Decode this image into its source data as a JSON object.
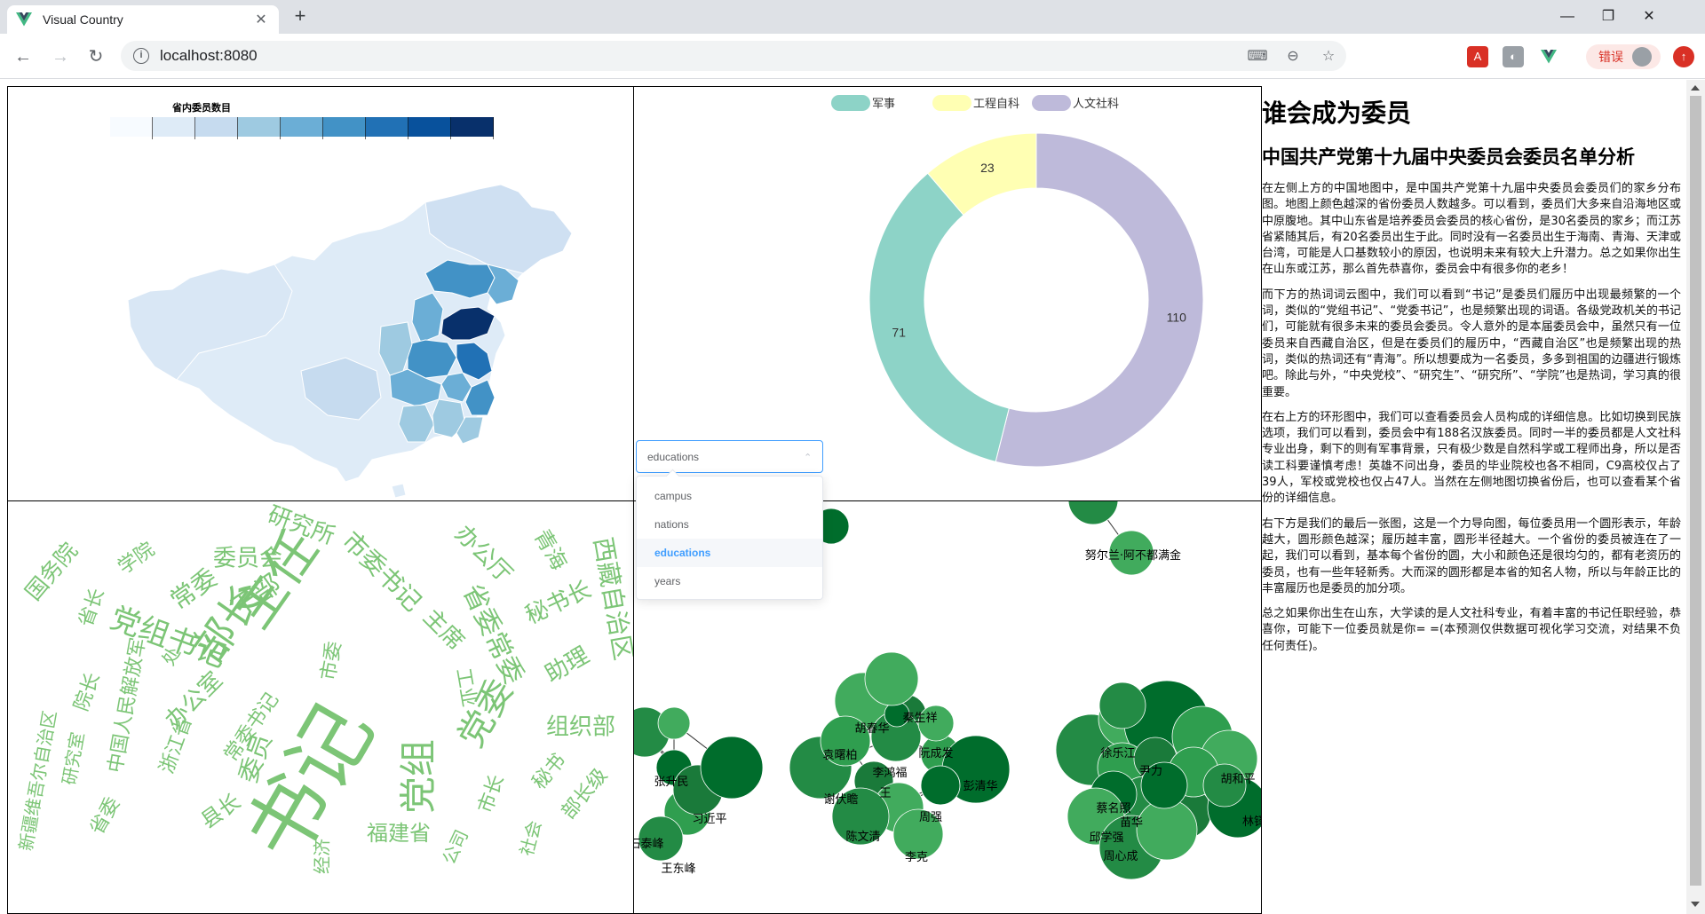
{
  "browser": {
    "tab_title": "Visual Country",
    "tab_close": "✕",
    "new_tab": "+",
    "url": "localhost:8080",
    "error_label": "错误",
    "win_minimize": "—",
    "win_maximize": "❐",
    "win_close": "✕"
  },
  "map": {
    "legend_title": "省内委员数目",
    "legend_ticks": [
      "0",
      "3",
      "7",
      "10",
      "13",
      "17",
      "20",
      "23",
      "27"
    ],
    "legend_colors": [
      "#f7fbff",
      "#deebf7",
      "#c6dbef",
      "#9ecae1",
      "#6baed6",
      "#4292c6",
      "#2171b5",
      "#08519c",
      "#08306b"
    ]
  },
  "donut": {
    "legend": [
      {
        "label": "军事",
        "color": "#8dd3c7"
      },
      {
        "label": "工程自科",
        "color": "#ffffb3"
      },
      {
        "label": "人文社科",
        "color": "#bebada"
      }
    ],
    "slices": [
      {
        "label": "人文社科",
        "value": 110,
        "color": "#bebada"
      },
      {
        "label": "军事",
        "value": 71,
        "color": "#8dd3c7"
      },
      {
        "label": "工程自科",
        "value": 23,
        "color": "#ffffb3"
      }
    ]
  },
  "select": {
    "value": "educations",
    "options": [
      "campus",
      "nations",
      "educations",
      "years"
    ],
    "selected_index": 2
  },
  "wordcloud": {
    "color": "#7cc576",
    "words": [
      "书记",
      "主任",
      "部长",
      "党组",
      "党委",
      "党组书记",
      "市委书记",
      "研究所",
      "委员会",
      "干部",
      "常委",
      "国务院",
      "学院",
      "省委常委",
      "秘书长",
      "办公厅",
      "青海",
      "西藏自治区",
      "主席",
      "助理",
      "组织部",
      "工业",
      "市委",
      "办公室",
      "委员",
      "处",
      "院长",
      "中国人民解放军",
      "研究室",
      "新疆维吾尔自治区",
      "浙江省",
      "常委书记",
      "县长",
      "经济",
      "福建省",
      "公司",
      "市长",
      "秘书",
      "部长级",
      "社会",
      "省长",
      "省委"
    ]
  },
  "force": {
    "names": [
      "努尔兰·阿不都满金",
      "张升民",
      "习近平",
      "王东峰",
      "胡春华",
      "秦生祥",
      "袁曙柏",
      "李鸿福",
      "阮成发",
      "谢伏瞻",
      "彭清华",
      "周强",
      "陈文清",
      "李克",
      "徐乐江",
      "蔡名照",
      "邱学强",
      "周心成",
      "尹力",
      "胡和平",
      "林铎",
      "王",
      "苗华",
      "石泰峰"
    ]
  },
  "article": {
    "title": "谁会成为委员",
    "subtitle": "中国共产党第十九届中央委员会委员名单分析",
    "paragraphs": [
      "在左侧上方的中国地图中，是中国共产党第十九届中央委员会委员们的家乡分布图。地图上颜色越深的省份委员人数越多。可以看到，委员们大多来自沿海地区或中原腹地。其中山东省是培养委员会委员的核心省份，是30名委员的家乡；而江苏省紧随其后，有20名委员出生于此。同时没有一名委员出生于海南、青海、天津或台湾，可能是人口基数较小的原因，也说明未来有较大上升潜力。总之如果你出生在山东或江苏，那么首先恭喜你，委员会中有很多你的老乡！",
      "而下方的热词词云图中，我们可以看到“书记”是委员们履历中出现最频繁的一个词，类似的“党组书记”、“党委书记”，也是频繁出现的词语。各级党政机关的书记们，可能就有很多未来的委员会委员。令人意外的是本届委员会中，虽然只有一位委员来自西藏自治区，但是在委员们的履历中，“西藏自治区”也是频繁出现的热词，类似的热词还有“青海”。所以想要成为一名委员，多多到祖国的边疆进行锻炼吧。除此与外，“中央党校”、“研究生”、“研究所”、“学院”也是热词，学习真的很重要。",
      "在右上方的环形图中，我们可以查看委员会人员构成的详细信息。比如切换到民族选项，我们可以看到，委员会中有188名汉族委员。同时一半的委员都是人文社科专业出身，剩下的则有军事背景，只有极少数是自然科学或工程师出身，所以是否读工科要谨慎考虑！英雄不问出身，委员的毕业院校也各不相同，C9高校仅占了39人，军校或党校也仅占47人。当然在左侧地图切换省份后，也可以查看某个省份的详细信息。",
      "右下方是我们的最后一张图，这是一个力导向图，每位委员用一个圆形表示，年龄越大，圆形颜色越深；履历越丰富，圆形半径越大。一个省份的委员被连在了一起，我们可以看到，基本每个省份的圆，大小和颜色还是很均匀的，都有老资历的委员，也有一些年轻新秀。大而深的圆形都是本省的知名人物，所以与年龄正比的丰富履历也是委员的加分项。",
      "总之如果你出生在山东，大学读的是人文社科专业，有着丰富的书记任职经验，恭喜你，可能下一位委员就是你= =(本预测仅供数据可视化学习交流，对结果不负任何责任)。"
    ]
  }
}
